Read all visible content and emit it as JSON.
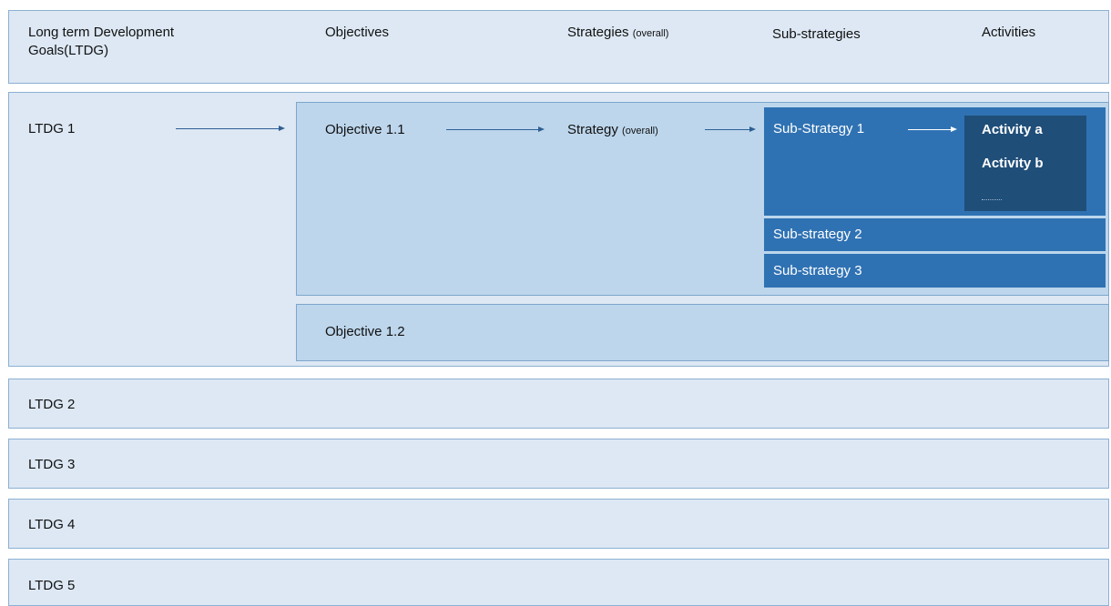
{
  "header": {
    "col1": "Long term Development Goals(LTDG)",
    "col2": "Objectives",
    "col3_main": "Strategies",
    "col3_sub": "(overall)",
    "col4": "Sub-strategies",
    "col5": "Activities"
  },
  "ltdg1": {
    "label": "LTDG 1",
    "objective_1": {
      "label": "Objective 1.1",
      "strategy_main": "Strategy",
      "strategy_sub": "(overall)",
      "sub_strategies": [
        "Sub-Strategy 1",
        "Sub-strategy 2",
        "Sub-strategy 3"
      ],
      "activities": [
        "Activity a",
        "Activity b"
      ]
    },
    "objective_2": {
      "label": "Objective 1.2"
    }
  },
  "other_goals": [
    "LTDG 2",
    "LTDG 3",
    "LTDG 4",
    "LTDG 5"
  ]
}
